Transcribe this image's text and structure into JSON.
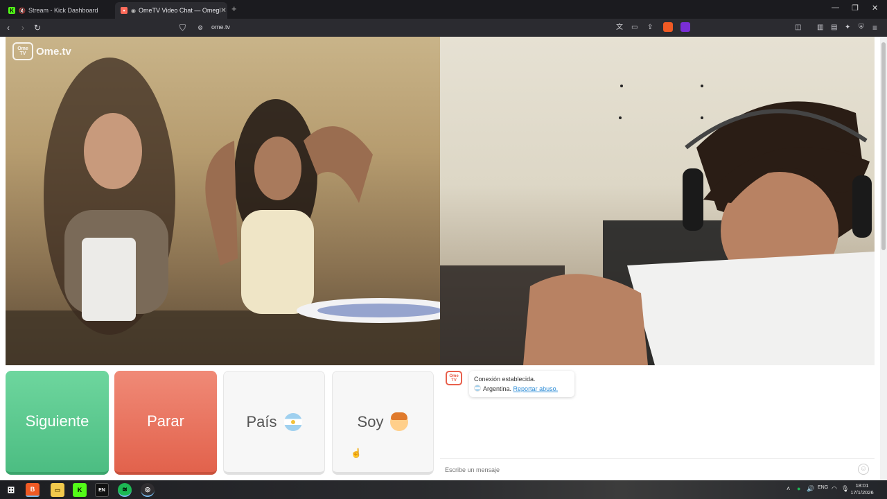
{
  "browser": {
    "tabs": [
      {
        "title": "Stream - Kick Dashboard",
        "active": false
      },
      {
        "title": "OmeTV Video Chat — Omegl",
        "active": true
      }
    ],
    "new_tab_icon": "plus-icon",
    "window_controls": [
      "minimize-icon",
      "restore-icon",
      "close-icon"
    ],
    "url": "ome.tv"
  },
  "site": {
    "logo_badge": "Ome TV",
    "logo_text": "Ome.tv"
  },
  "controls": {
    "next_label": "Siguiente",
    "stop_label": "Parar",
    "country_label": "País",
    "gender_label": "Soy",
    "colors": {
      "next": "#4cbd82",
      "stop": "#e2624c"
    }
  },
  "chat": {
    "logo_badge": "Ome TV",
    "status_line": "Conexión establecida.",
    "country": "Argentina.",
    "report_link": "Reportar abuso.",
    "input_placeholder": "Escribe un mensaje",
    "emoji_icon": "smiley-icon"
  },
  "taskbar": {
    "lang": "ENG",
    "time": "18:01",
    "date": "17/1/2026"
  }
}
